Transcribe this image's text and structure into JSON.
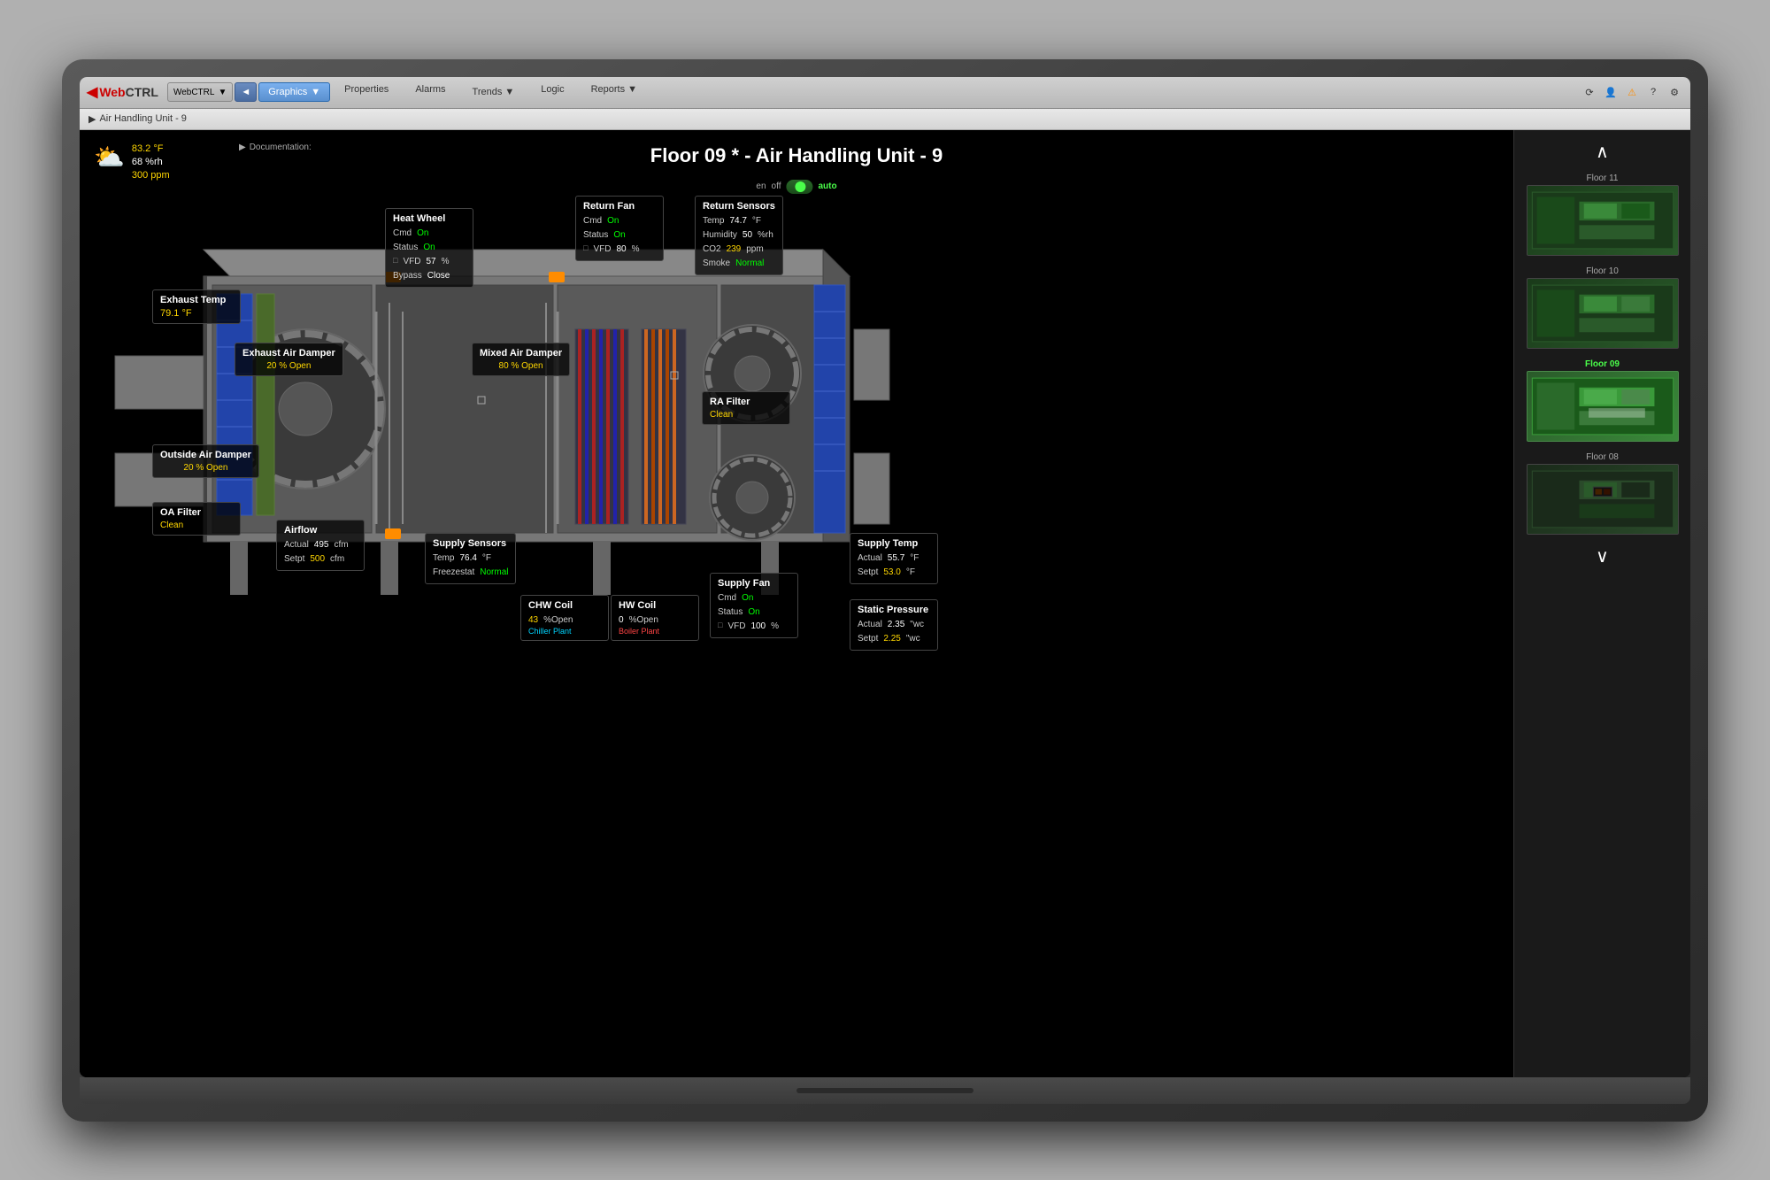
{
  "app": {
    "logo_web": "Web",
    "logo_ctrl": "CTRL",
    "nav_back": "◄",
    "nav_dropdown": "▼"
  },
  "nav": {
    "graphics_label": "Graphics",
    "properties_label": "Properties",
    "alarms_label": "Alarms",
    "trends_label": "Trends",
    "logic_label": "Logic",
    "reports_label": "Reports"
  },
  "breadcrumb": {
    "text": "Air Handling Unit - 9"
  },
  "header": {
    "title": "Floor 09 *  -  Air Handling Unit - 9"
  },
  "weather": {
    "temp": "83.2 °F",
    "humidity": "68 %rh",
    "co2": "300 ppm"
  },
  "mode": {
    "en": "en",
    "off": "off",
    "auto": "auto"
  },
  "heat_wheel": {
    "title": "Heat Wheel",
    "cmd_label": "Cmd",
    "cmd_value": "On",
    "status_label": "Status",
    "status_value": "On",
    "vfd_label": "VFD",
    "vfd_value": "57",
    "vfd_unit": "%",
    "bypass_label": "Bypass",
    "bypass_value": "Close"
  },
  "return_fan": {
    "title": "Return Fan",
    "cmd_label": "Cmd",
    "cmd_value": "On",
    "status_label": "Status",
    "status_value": "On",
    "vfd_label": "VFD",
    "vfd_value": "80",
    "vfd_unit": "%"
  },
  "return_sensors": {
    "title": "Return Sensors",
    "temp_label": "Temp",
    "temp_value": "74.7",
    "temp_unit": "°F",
    "humidity_label": "Humidity",
    "humidity_value": "50",
    "humidity_unit": "%rh",
    "co2_label": "CO2",
    "co2_value": "239",
    "co2_unit": "ppm",
    "smoke_label": "Smoke",
    "smoke_value": "Normal"
  },
  "exhaust_temp": {
    "title": "Exhaust Temp",
    "value": "79.1 °F"
  },
  "exhaust_air_damper": {
    "title": "Exhaust Air Damper",
    "percent": "20",
    "unit": "% Open"
  },
  "mixed_air_damper": {
    "title": "Mixed Air Damper",
    "percent": "80",
    "unit": "% Open"
  },
  "ra_filter": {
    "title": "RA Filter",
    "status": "Clean"
  },
  "oa_filter": {
    "title": "OA Filter",
    "status": "Clean"
  },
  "outside_air_damper": {
    "title": "Outside Air Damper",
    "percent": "20",
    "unit": "% Open"
  },
  "airflow": {
    "title": "Airflow",
    "actual_label": "Actual",
    "actual_value": "495",
    "actual_unit": "cfm",
    "setpt_label": "Setpt",
    "setpt_value": "500",
    "setpt_unit": "cfm"
  },
  "supply_sensors": {
    "title": "Supply Sensors",
    "temp_label": "Temp",
    "temp_value": "76.4",
    "temp_unit": "°F",
    "freezestat_label": "Freezestat",
    "freezestat_value": "Normal"
  },
  "chw_coil": {
    "title": "CHW Coil",
    "percent": "43",
    "unit": "%Open",
    "link": "Chiller Plant"
  },
  "hw_coil": {
    "title": "HW Coil",
    "percent": "0",
    "unit": "%Open",
    "link": "Boiler Plant"
  },
  "supply_fan": {
    "title": "Supply Fan",
    "cmd_label": "Cmd",
    "cmd_value": "On",
    "status_label": "Status",
    "status_value": "On",
    "vfd_label": "VFD",
    "vfd_value": "100",
    "vfd_unit": "%"
  },
  "supply_temp": {
    "title": "Supply Temp",
    "actual_label": "Actual",
    "actual_value": "55.7",
    "actual_unit": "°F",
    "setpt_label": "Setpt",
    "setpt_value": "53.0",
    "setpt_unit": "°F"
  },
  "static_pressure": {
    "title": "Static Pressure",
    "actual_label": "Actual",
    "actual_value": "2.35",
    "actual_unit": "\"wc",
    "setpt_label": "Setpt",
    "setpt_value": "2.25",
    "setpt_unit": "\"wc"
  },
  "floors": [
    {
      "label": "Floor 11",
      "active": false,
      "color": "11"
    },
    {
      "label": "Floor 10",
      "active": false,
      "color": "10"
    },
    {
      "label": "Floor 09",
      "active": true,
      "color": "09"
    },
    {
      "label": "Floor 08",
      "active": false,
      "color": "08"
    }
  ],
  "sidebar_up": "∧",
  "sidebar_down": "∨"
}
